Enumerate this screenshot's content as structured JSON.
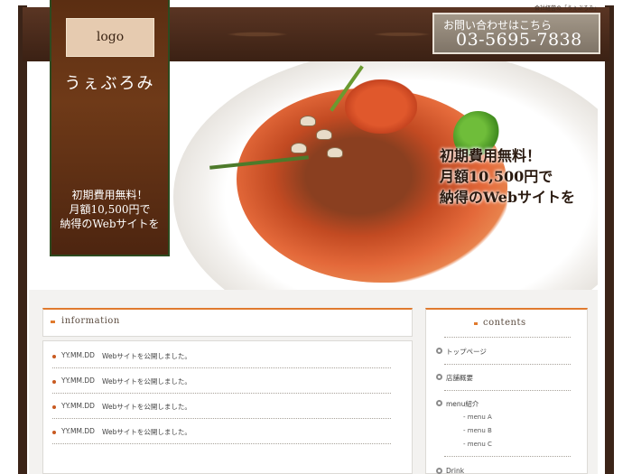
{
  "header": {
    "tagline": "会社経営の「うぇぶろみ」",
    "contact_label": "お問い合わせはこちら",
    "phone": "03-5695-7838"
  },
  "logo": {
    "text": "logo",
    "brand": "うぇぶろみ",
    "copy_line1": "初期費用無料！",
    "copy_line2": "月額10,500円で",
    "copy_line3": "納得のWebサイトを"
  },
  "hero": {
    "line1": "初期費用無料！",
    "line2": "月額10,500円で",
    "line3": "納得のWebサイトを"
  },
  "information": {
    "title": "information",
    "items": [
      {
        "date": "YY.MM.DD",
        "text": "Webサイトを公開しました。"
      },
      {
        "date": "YY.MM.DD",
        "text": "Webサイトを公開しました。"
      },
      {
        "date": "YY.MM.DD",
        "text": "Webサイトを公開しました。"
      },
      {
        "date": "YY.MM.DD",
        "text": "Webサイトを公開しました。"
      }
    ]
  },
  "contents": {
    "title": "contents",
    "items": [
      "トップページ",
      "店舗概要",
      "menu紹介",
      "Drink"
    ],
    "sub_items": [
      "menu A",
      "menu B",
      "menu C"
    ]
  },
  "colors": {
    "accent": "#e07a2e",
    "header_brown": "#4a2a1a",
    "logo_panel": "#5b2e12"
  }
}
